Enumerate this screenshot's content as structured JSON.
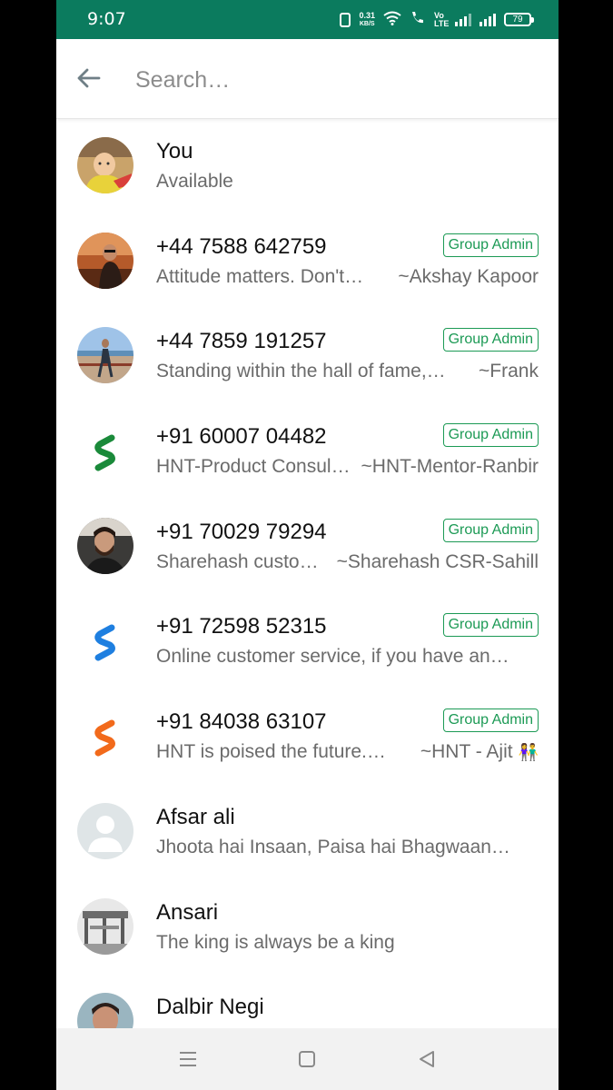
{
  "status_bar": {
    "time": "9:07",
    "net_speed_value": "0.31",
    "net_speed_unit": "KB/S",
    "volte": "Vo LTE",
    "battery": "79",
    "colors": {
      "bar": "#0b7b5e"
    }
  },
  "search": {
    "placeholder": "Search…",
    "back_icon": "arrow-left-icon"
  },
  "contacts": [
    {
      "name": "You",
      "status": "Available",
      "pushname": "",
      "badge": "",
      "avatar": "photo-baby"
    },
    {
      "name": "+44 7588 642759",
      "status": "Attitude matters. Don't…",
      "pushname": "~Akshay Kapoor",
      "badge": "Group Admin",
      "avatar": "photo-man-sunset"
    },
    {
      "name": "+44 7859 191257",
      "status": "Standing within the hall of fame,…",
      "pushname": "~Frank",
      "badge": "Group Admin",
      "avatar": "photo-beach"
    },
    {
      "name": "+91 60007 04482",
      "status": "HNT-Product Consul…",
      "pushname": "~HNT-Mentor-Ranbir",
      "badge": "Group Admin",
      "avatar": "logo-s-green"
    },
    {
      "name": "+91 70029 79294",
      "status": "Sharehash custo…",
      "pushname": "~Sharehash CSR-Sahill",
      "badge": "Group Admin",
      "avatar": "photo-man-car"
    },
    {
      "name": "+91 72598 52315",
      "status": "Online customer service, if you have an…",
      "pushname": "",
      "badge": "Group Admin",
      "avatar": "logo-s-blue"
    },
    {
      "name": "+91 84038 63107",
      "status": "HNT is poised the future.…",
      "pushname": "~HNT - Ajit",
      "badge": "Group Admin",
      "avatar": "logo-s-orange"
    },
    {
      "name": "Afsar ali",
      "status": "Jhoota hai Insaan, Paisa hai Bhagwaan…",
      "pushname": "",
      "badge": "",
      "avatar": "default-avatar"
    },
    {
      "name": "Ansari",
      "status": "The king is always be a king",
      "pushname": "",
      "badge": "",
      "avatar": "photo-building"
    },
    {
      "name": "Dalbir Negi",
      "status": "",
      "pushname": "",
      "badge": "",
      "avatar": "photo-man-face"
    }
  ],
  "nav": {
    "menu": "menu-icon",
    "home": "home-icon",
    "back": "back-triangle-icon"
  },
  "colors": {
    "badge": "#1c9a55",
    "header": "#0b7b5e"
  }
}
